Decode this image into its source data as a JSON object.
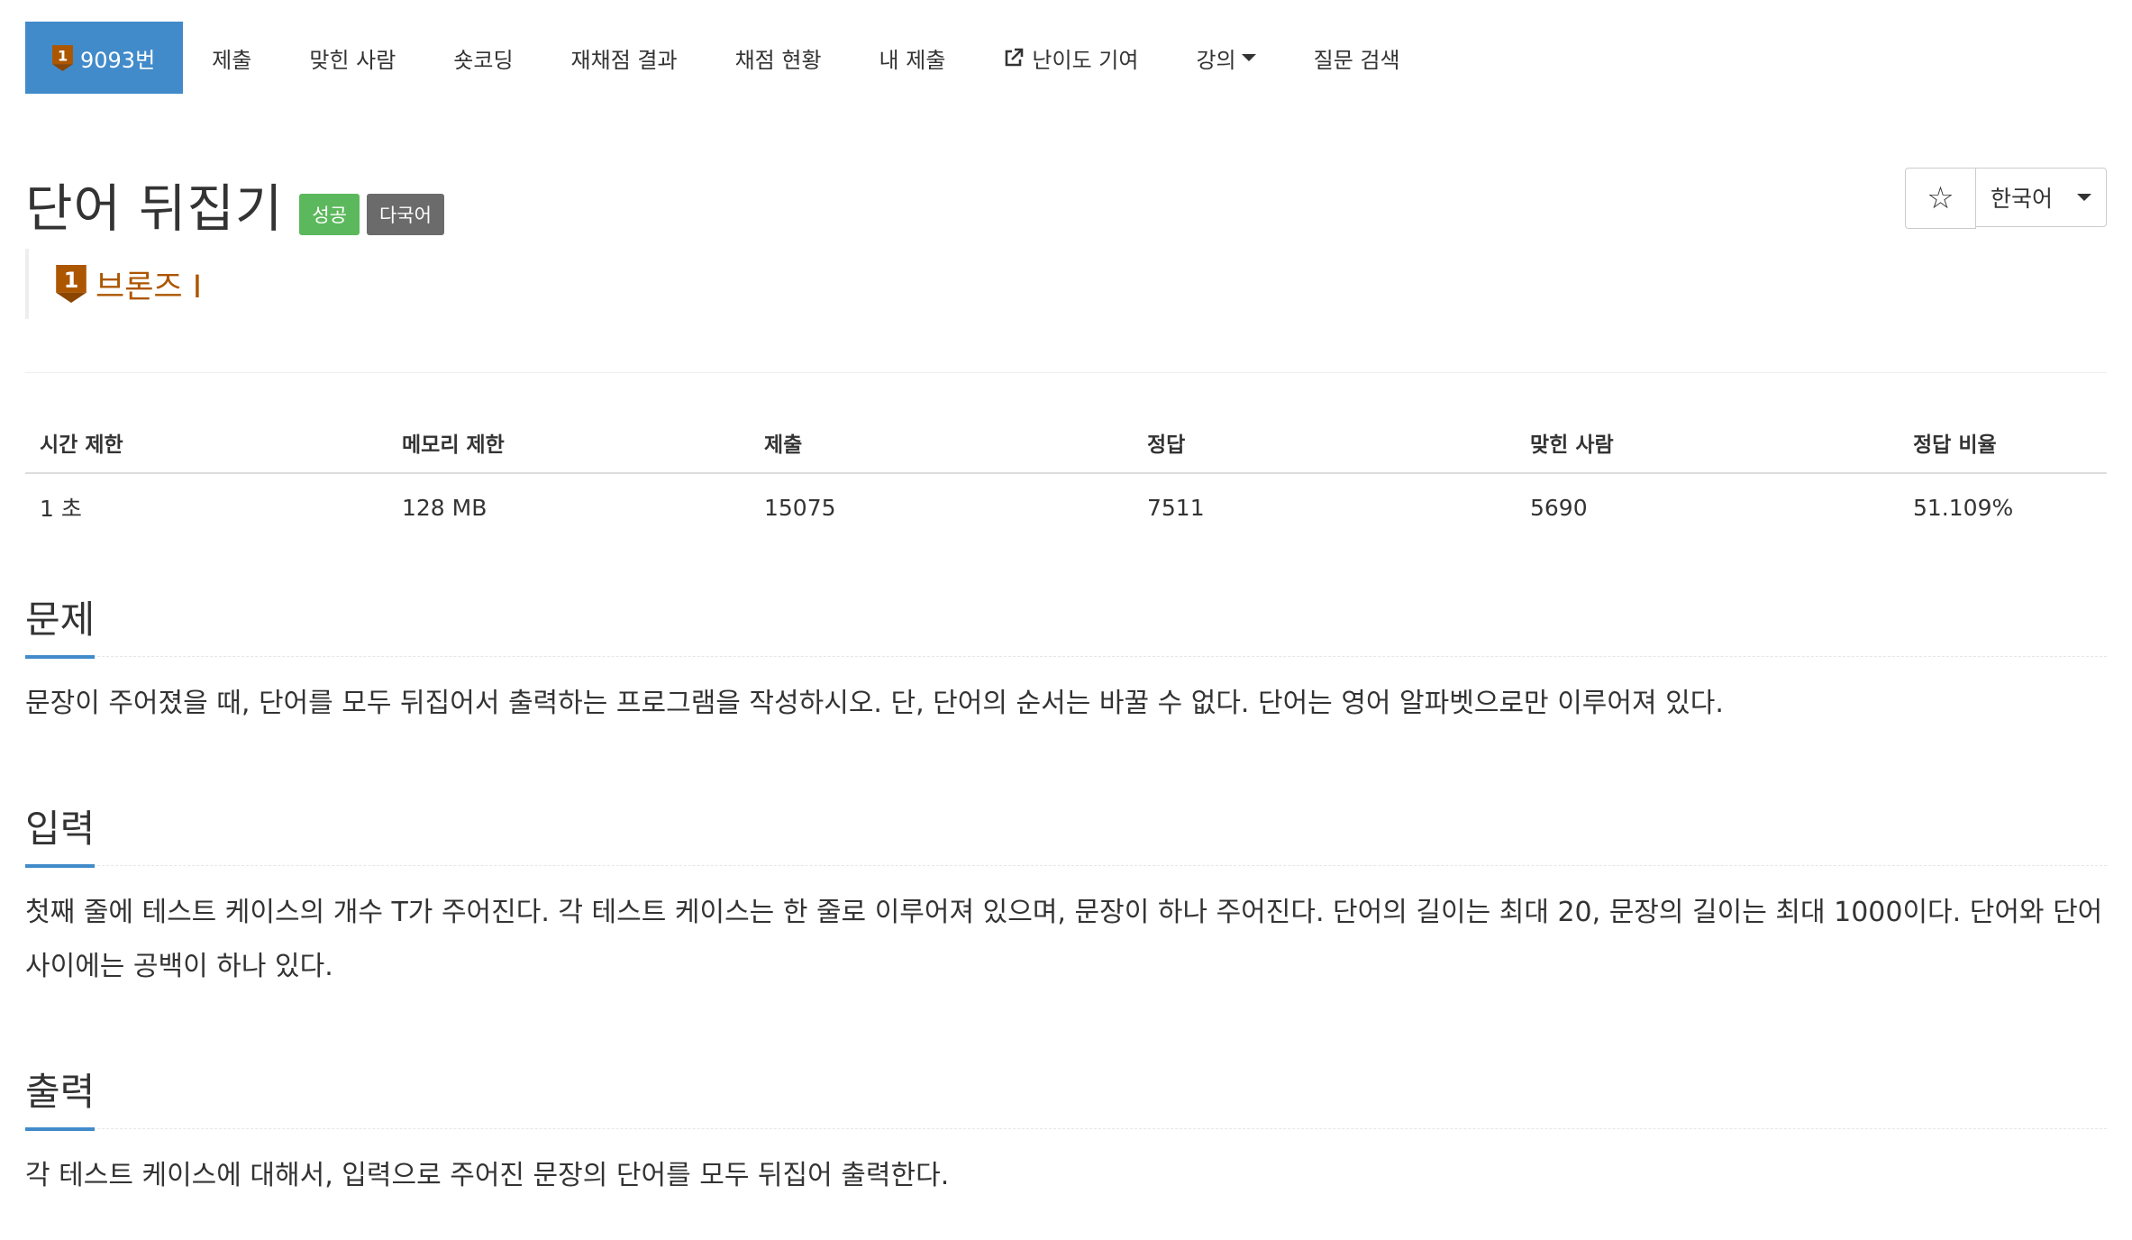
{
  "nav": {
    "problem_number": "9093번",
    "items": [
      {
        "label": "제출"
      },
      {
        "label": "맞힌 사람"
      },
      {
        "label": "숏코딩"
      },
      {
        "label": "재채점 결과"
      },
      {
        "label": "채점 현황"
      },
      {
        "label": "내 제출"
      },
      {
        "label": "난이도 기여"
      },
      {
        "label": "강의"
      },
      {
        "label": "질문 검색"
      }
    ]
  },
  "problem": {
    "title": "단어 뒤집기",
    "labels": {
      "status": "성공",
      "multilang": "다국어"
    },
    "tier": "브론즈 I",
    "tier_badge": "1",
    "tier_color": "#ad5600"
  },
  "tools": {
    "star": "☆",
    "language": "한국어"
  },
  "info": {
    "headers": [
      "시간 제한",
      "메모리 제한",
      "제출",
      "정답",
      "맞힌 사람",
      "정답 비율"
    ],
    "values": [
      "1 초",
      "128 MB",
      "15075",
      "7511",
      "5690",
      "51.109%"
    ]
  },
  "sections": {
    "problem": {
      "title": "문제",
      "body": "문장이 주어졌을 때, 단어를 모두 뒤집어서 출력하는 프로그램을 작성하시오. 단, 단어의 순서는 바꿀 수 없다. 단어는 영어 알파벳으로만 이루어져 있다."
    },
    "input": {
      "title": "입력",
      "body": "첫째 줄에 테스트 케이스의 개수 T가 주어진다. 각 테스트 케이스는 한 줄로 이루어져 있으며, 문장이 하나 주어진다. 단어의 길이는 최대 20, 문장의 길이는 최대 1000이다. 단어와 단어 사이에는 공백이 하나 있다."
    },
    "output": {
      "title": "출력",
      "body": "각 테스트 케이스에 대해서, 입력으로 주어진 문장의 단어를 모두 뒤집어 출력한다."
    }
  },
  "colors": {
    "accent": "#428bca",
    "success": "#5cb85c",
    "bronze": "#ad5600"
  }
}
